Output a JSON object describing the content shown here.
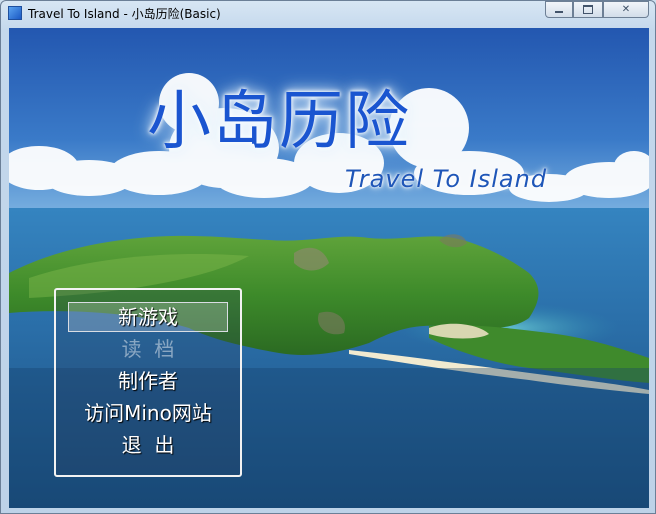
{
  "window": {
    "title": "Travel To Island - 小岛历险(Basic)",
    "controls": {
      "minimize_icon": "minimize-icon",
      "maximize_icon": "maximize-icon",
      "close_icon": "close-icon",
      "close_glyph": "✕"
    }
  },
  "game": {
    "logo_cn": "小岛历险",
    "logo_en": "Travel To Island",
    "menu": [
      {
        "label": "新游戏",
        "state": "selected"
      },
      {
        "label": "读  档",
        "state": "disabled"
      },
      {
        "label": "制作者",
        "state": "normal"
      },
      {
        "label": "访问Mino网站",
        "state": "normal"
      },
      {
        "label": "退  出",
        "state": "normal"
      }
    ]
  },
  "colors": {
    "logo_blue": "#1a55d0",
    "sky_blue": "#2a62b4",
    "sea_blue": "#215b8e",
    "menu_border": "#f2f2f2"
  }
}
